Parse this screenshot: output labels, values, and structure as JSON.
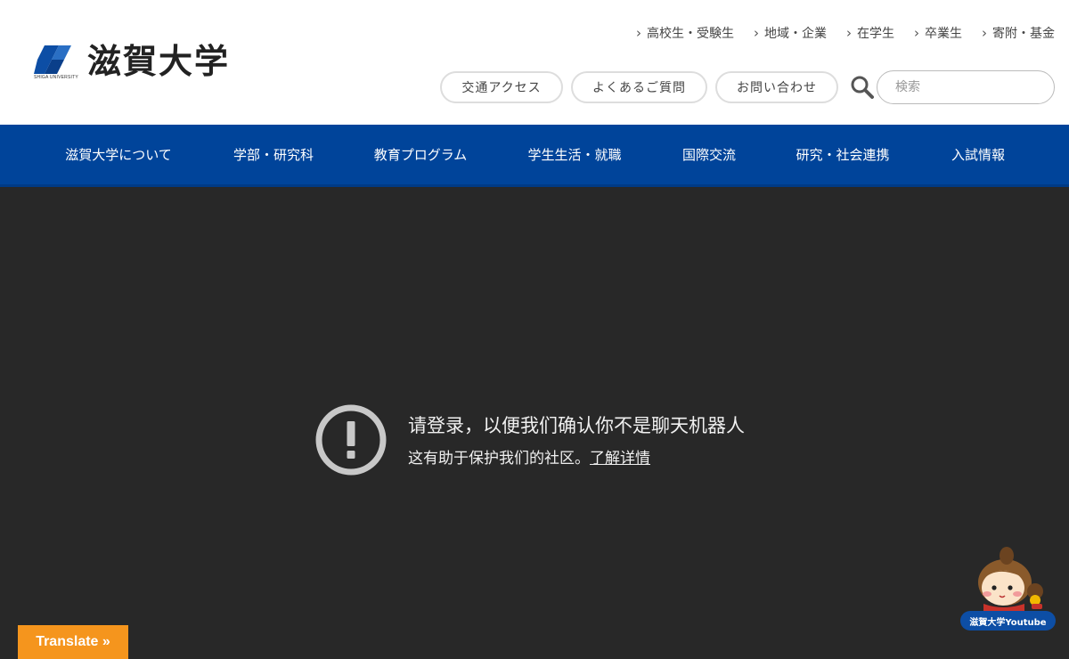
{
  "site": {
    "name": "滋賀大学",
    "subname": "SHIGA UNIVERSITY"
  },
  "toplinks": [
    {
      "label": "高校生・受験生"
    },
    {
      "label": "地域・企業"
    },
    {
      "label": "在学生"
    },
    {
      "label": "卒業生"
    },
    {
      "label": "寄附・基金"
    }
  ],
  "utility": {
    "access": "交通アクセス",
    "faq": "よくあるご質問",
    "contact": "お問い合わせ",
    "search_placeholder": "検索"
  },
  "nav": [
    {
      "label": "滋賀大学について"
    },
    {
      "label": "学部・研究科"
    },
    {
      "label": "教育プログラム"
    },
    {
      "label": "学生生活・就職"
    },
    {
      "label": "国際交流"
    },
    {
      "label": "研究・社会連携"
    },
    {
      "label": "入試情報"
    }
  ],
  "login_notice": {
    "title": "请登录，以便我们确认你不是聊天机器人",
    "subtitle": "这有助于保护我们的社区。",
    "link": "了解详情"
  },
  "translate": {
    "label": "Translate »"
  },
  "youtube_widget": {
    "label": "滋賀大学Youtube"
  },
  "colors": {
    "nav_bg": "#00449a",
    "overlay_bg": "#282828",
    "translate_bg": "#f5951d",
    "badge_bg": "#0d4ea5"
  }
}
